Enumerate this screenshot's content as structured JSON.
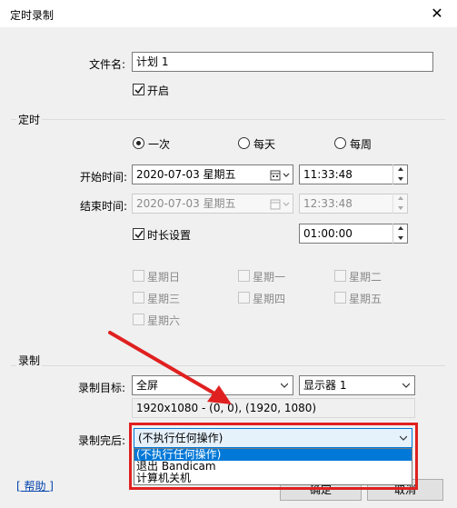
{
  "window": {
    "title": "定时录制",
    "close_glyph": "✕"
  },
  "filename": {
    "label": "文件名:",
    "value": "计划 1"
  },
  "enable": {
    "label": "开启",
    "checked": true
  },
  "schedule": {
    "group_title": "定时",
    "radios": [
      {
        "label": "一次",
        "checked": true
      },
      {
        "label": "每天",
        "checked": false
      },
      {
        "label": "每周",
        "checked": false
      }
    ],
    "start": {
      "label": "开始时间:",
      "date": "2020-07-03 星期五",
      "time": "11:33:48"
    },
    "end": {
      "label": "结束时间:",
      "date": "2020-07-03 星期五",
      "time": "12:33:48"
    },
    "duration": {
      "label": "时长设置",
      "checked": true,
      "value": "01:00:00"
    },
    "weekdays": [
      "星期日",
      "星期一",
      "星期二",
      "星期三",
      "星期四",
      "星期五",
      "星期六"
    ]
  },
  "record": {
    "group_title": "录制",
    "target_label": "录制目标:",
    "target_value": "全屏",
    "monitor_value": "显示器 1",
    "coords_text": "1920x1080 - (0, 0), (1920, 1080)",
    "after_label": "录制完后:",
    "after_value": "(不执行任何操作)",
    "after_options": [
      "(不执行任何操作)",
      "退出 Bandicam",
      "计算机关机"
    ]
  },
  "footer": {
    "help_link": "[ 帮助 ]",
    "ok_label": "确定",
    "cancel_label": "取消"
  },
  "colors": {
    "highlight": "#0078d7",
    "annotation_red": "#e02020",
    "dialog_bg": "#f0f0f0"
  }
}
